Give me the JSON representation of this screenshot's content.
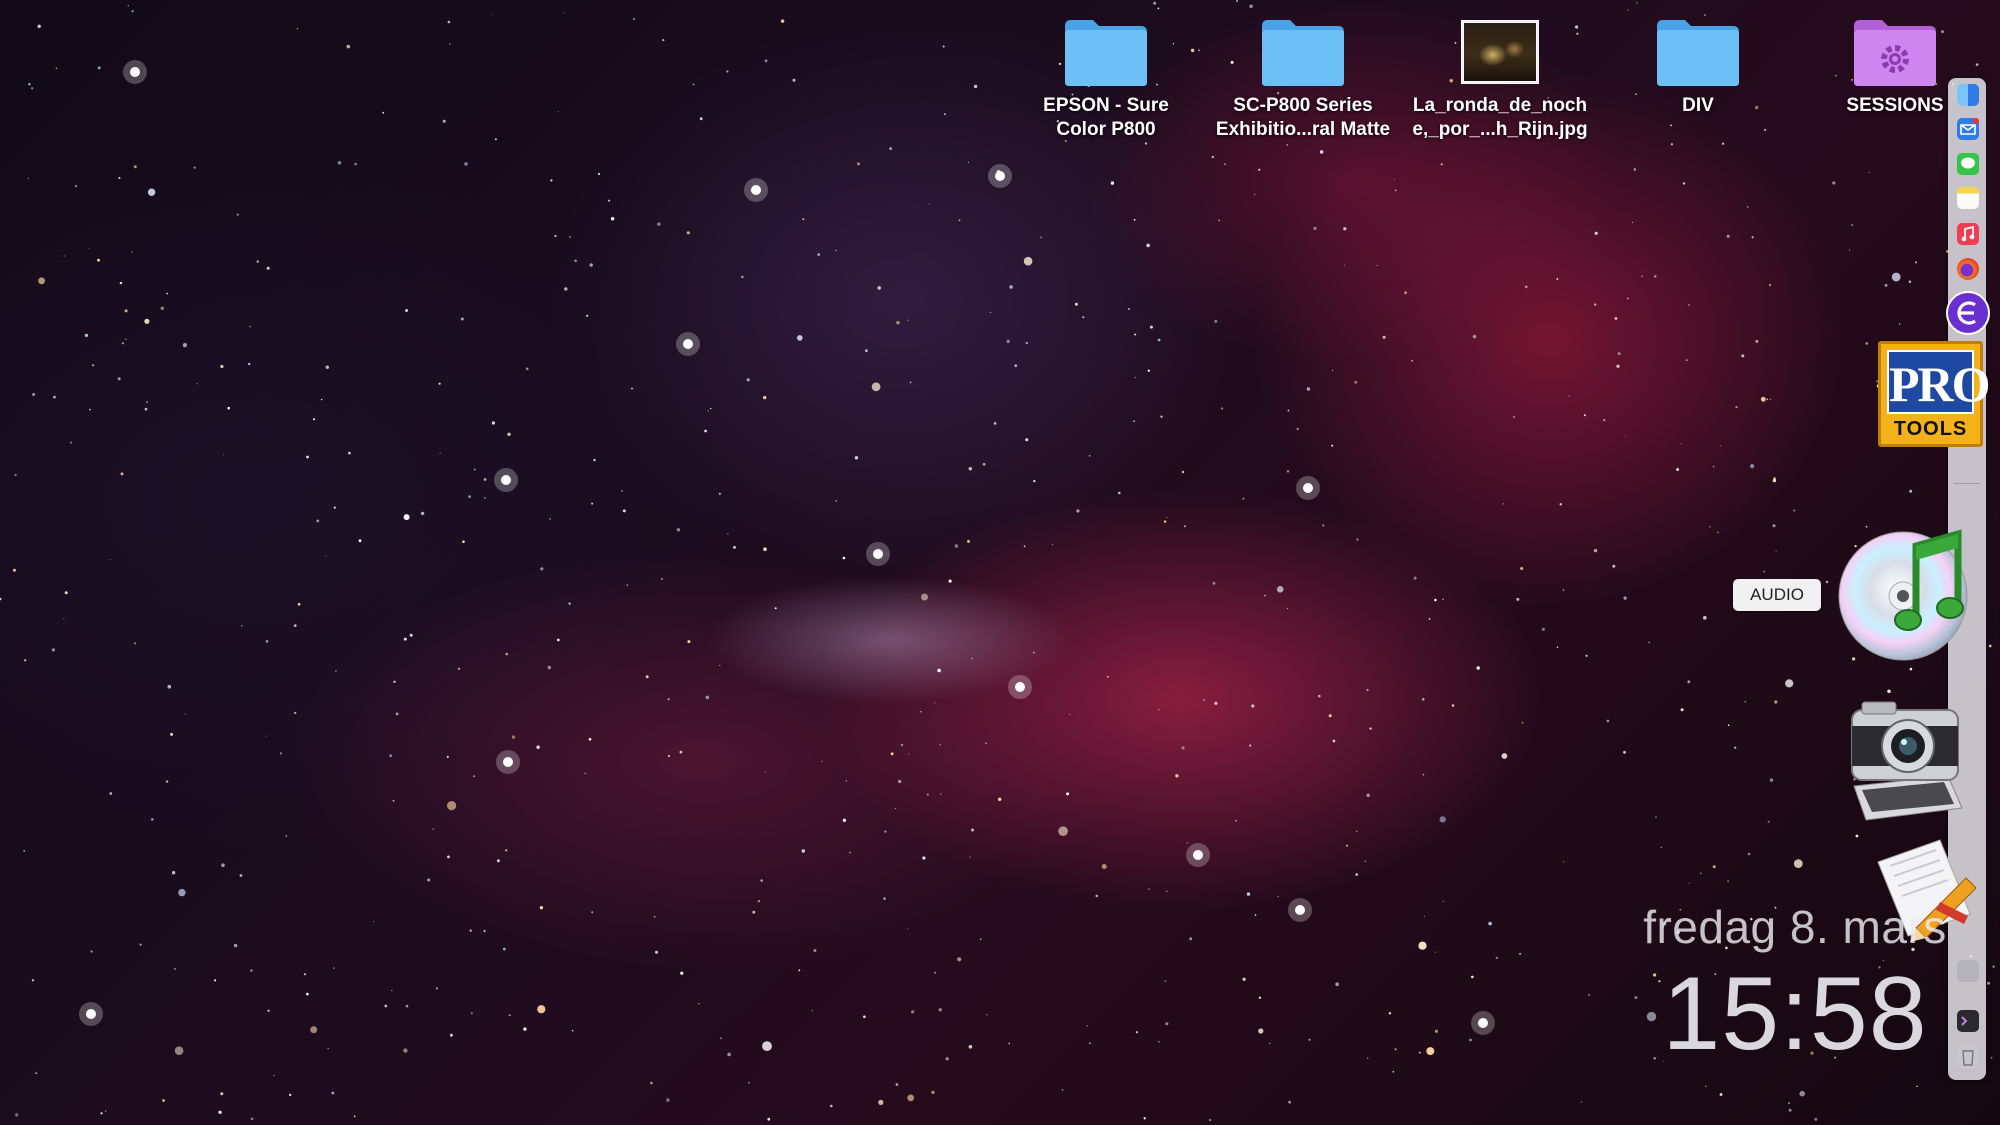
{
  "desktop": {
    "icons": [
      {
        "label_line1": "EPSON - Sure",
        "label_line2": "Color P800",
        "icon": "folder-icon"
      },
      {
        "label_line1": "SC-P800 Series",
        "label_line2": "Exhibitio...ral Matte",
        "icon": "folder-icon"
      },
      {
        "label_line1": "La_ronda_de_noch",
        "label_line2": "e,_por_...h_Rijn.jpg",
        "icon": "image-thumbnail-icon"
      },
      {
        "label_line1": "DIV",
        "label_line2": "",
        "icon": "folder-icon"
      },
      {
        "label_line1": "SESSIONS",
        "label_line2": "",
        "icon": "purple-settings-folder-icon"
      }
    ],
    "folder_color": "#5bb6f0",
    "sessions_folder_color": "#c777e6"
  },
  "dock": {
    "apps": [
      {
        "name": "finder-icon",
        "color": "#3d8ff0"
      },
      {
        "name": "mail-icon",
        "color": "#2f7be8"
      },
      {
        "name": "messages-icon",
        "color": "#37c34a"
      },
      {
        "name": "notes-icon",
        "color": "#f5d34c"
      },
      {
        "name": "music-icon",
        "color": "#f23c52"
      },
      {
        "name": "firefox-icon",
        "color": "#f07a1c"
      },
      {
        "name": "e-app-icon",
        "color": "#7b3fd6"
      }
    ],
    "protools": {
      "line1": "PRO",
      "line2": "TOOLS"
    }
  },
  "tooltip": {
    "text": "AUDIO"
  },
  "clock": {
    "date": "fredag 8. mars",
    "time": "15:58"
  }
}
